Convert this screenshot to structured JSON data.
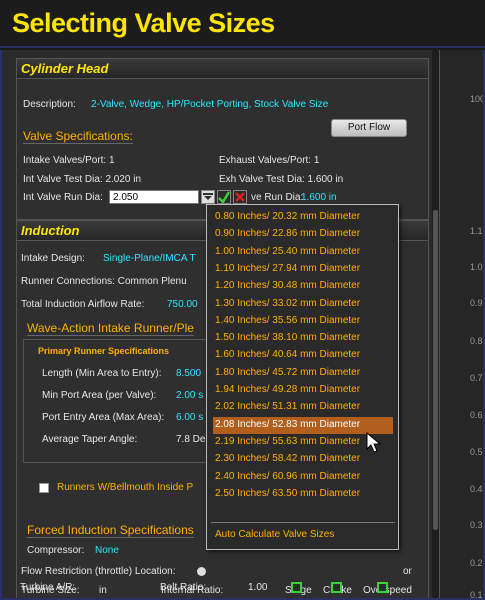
{
  "banner": {
    "title": "Selecting Valve Sizes"
  },
  "cylinder_head": {
    "title": "Cylinder Head",
    "description_label": "Description:",
    "description_value": "2-Valve, Wedge, HP/Pocket Porting, Stock Valve Size",
    "valve_specs_heading": "Valve Specifications:",
    "port_flow_button": "Port Flow",
    "intake_valves_port": "Intake Valves/Port:  1",
    "exhaust_valves_port": "Exhaust Valves/Port:  1",
    "int_valve_test_dia": "Int Valve Test Dia:  2.020 in",
    "exh_valve_test_dia": "Exh Valve Test Dia:  1.600 in",
    "int_valve_run_dia_label": "Int Valve Run Dia:",
    "int_valve_run_dia_value": "2.050",
    "exh_run_dia_label_partial": "ve Run Dia:",
    "exh_run_dia_value": "1.600 in"
  },
  "induction": {
    "title": "Induction",
    "intake_design_label": "Intake Design:",
    "intake_design_value": "Single-Plane/IMCA T",
    "runner_connections": "Runner Connections:  Common Plenu",
    "total_airflow_label": "Total Induction Airflow Rate:",
    "total_airflow_value": "750.00",
    "wave_action_heading": "Wave-Action Intake Runner/Ple",
    "primary_runner_heading": "Primary Runner Specifications",
    "length_label": "Length (Min Area to Entry):",
    "length_value": "8.500",
    "min_port_label": "Min Port Area (per Valve):",
    "min_port_value": "2.00 s",
    "port_entry_label": "Port Entry Area (Max Area):",
    "port_entry_value": "6.00 s",
    "taper_label": "Average Taper Angle:",
    "taper_value": "7.8 De",
    "bellmouth_label": "Runners W/Bellmouth Inside P",
    "forced_heading": "Forced Induction Specifications",
    "compressor_label": "Compressor:",
    "compressor_value": "None",
    "flow_restriction_label": "Flow Restriction (throttle) Location:",
    "flow_restriction_tail": "or",
    "turbine_size_label": "Turbine Size:",
    "turbine_size_unit": "in",
    "internal_ratio_label": "Internal Ratio:",
    "turbine_ar_label": "Turbine A/R:",
    "belt_ratio_label": "Belt Ratio:",
    "belt_ratio_value": "1.00",
    "surge_label": "Surge",
    "choke_label": "Choke",
    "overspeed_label": "Overspeed"
  },
  "right_axis": [
    "100",
    "1.1",
    "1.0",
    "0.9",
    "0.8",
    "0.7",
    "0.6",
    "0.5",
    "0.4",
    "0.3",
    "0.2",
    "0.1"
  ],
  "dropdown": {
    "items": [
      "0.80 Inches/ 20.32 mm Diameter",
      "0.90 Inches/ 22.86 mm Diameter",
      "1.00 Inches/ 25.40 mm Diameter",
      "1.10 Inches/ 27.94 mm Diameter",
      "1.20 Inches/ 30.48 mm Diameter",
      "1.30 Inches/ 33.02 mm Diameter",
      "1.40 Inches/ 35.56 mm Diameter",
      "1.50 Inches/ 38.10 mm Diameter",
      "1.60 Inches/ 40.64 mm Diameter",
      "1.80 Inches/ 45.72 mm Diameter",
      "1.94 Inches/ 49.28 mm Diameter",
      "2.02 Inches/ 51.31 mm Diameter",
      "2.08 Inches/ 52.83 mm Diameter",
      "2.19 Inches/ 55.63 mm Diameter",
      "2.30 Inches/ 58.42 mm Diameter",
      "2.40 Inches/ 60.96 mm Diameter",
      "2.50 Inches/ 63.50 mm Diameter"
    ],
    "selected_index": 12,
    "auto_calculate": "Auto Calculate Valve Sizes"
  },
  "colors": {
    "accent": "#ffe600",
    "orange": "#ffb000",
    "cyan": "#2ee6ff",
    "selected": "#b25e1c"
  }
}
